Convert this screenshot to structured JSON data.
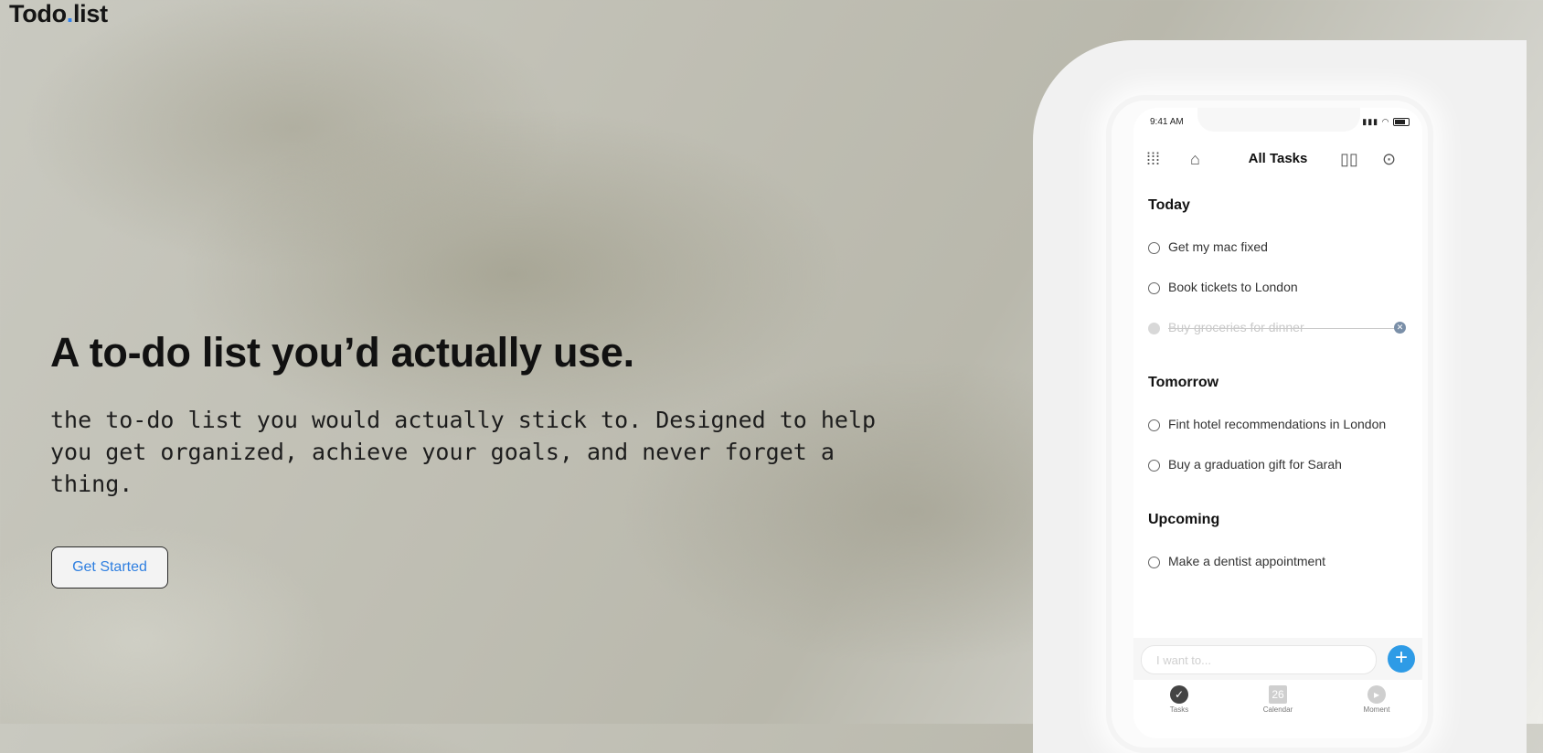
{
  "brand": {
    "name_part1": "Todo",
    "dot": ".",
    "name_part2": "list"
  },
  "hero": {
    "headline": "A to-do list you’d actually use.",
    "subtext": "the to-do list you would actually stick to. Designed to help\nyou get organized, achieve your goals, and never forget a\nthing.",
    "cta_label": "Get Started"
  },
  "phone": {
    "status_time": "9:41 AM",
    "title": "All Tasks",
    "sections": [
      {
        "title": "Today",
        "tasks": [
          {
            "label": "Get my mac fixed",
            "done": false
          },
          {
            "label": "Book tickets to London",
            "done": false
          },
          {
            "label": "Buy groceries for dinner",
            "done": true
          }
        ]
      },
      {
        "title": "Tomorrow",
        "tasks": [
          {
            "label": "Fint hotel recommendations in London",
            "done": false
          },
          {
            "label": "Buy a graduation gift for Sarah",
            "done": false
          }
        ]
      },
      {
        "title": "Upcoming",
        "tasks": [
          {
            "label": "Make a dentist appointment",
            "done": false
          }
        ]
      }
    ],
    "input_placeholder": "I want to...",
    "tabs": [
      {
        "label": "Tasks",
        "icon": "check-circle-icon"
      },
      {
        "label": "Calendar",
        "icon": "calendar-icon",
        "day": "26"
      },
      {
        "label": "Moment",
        "icon": "moment-icon"
      }
    ]
  },
  "colors": {
    "accent": "#2f80ed",
    "add_button": "#2e9be6"
  }
}
